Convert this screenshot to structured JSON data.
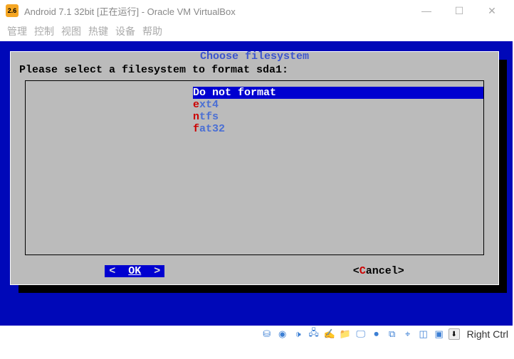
{
  "window": {
    "icon_label": "2.6",
    "title": "Android 7.1 32bit [正在运行] - Oracle VM VirtualBox"
  },
  "menu": {
    "items": [
      "管理",
      "控制",
      "视图",
      "热键",
      "设备",
      "帮助"
    ]
  },
  "dialog": {
    "title": "Choose filesystem",
    "prompt": "Please select a filesystem to format sda1:",
    "options": [
      {
        "hotkey": "D",
        "rest": "o not format",
        "selected": true
      },
      {
        "hotkey": "e",
        "rest": "xt4          ",
        "selected": false
      },
      {
        "hotkey": "n",
        "rest": "tfs          ",
        "selected": false
      },
      {
        "hotkey": "f",
        "rest": "at32         ",
        "selected": false
      }
    ],
    "ok_label": "OK",
    "cancel_label": "ancel",
    "cancel_hotkey": "C"
  },
  "statusbar": {
    "icons": [
      "hdd-icon",
      "optical-icon",
      "audio-icon",
      "net-icon",
      "usb-icon",
      "shared-icon",
      "display-icon",
      "record-icon",
      "clip-icon",
      "mouse-icon",
      "window-icon",
      "cpu-icon"
    ],
    "host_key": "Right Ctrl"
  }
}
